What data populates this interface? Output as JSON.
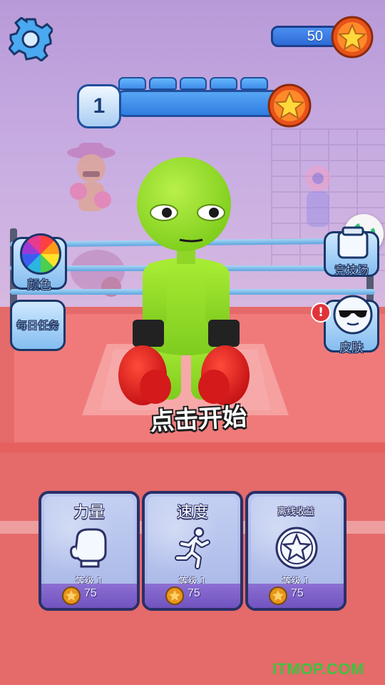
{
  "top": {
    "settings_icon": "gear-icon",
    "coins": "50",
    "coin_icon": "star-coin-icon"
  },
  "level": {
    "current": "1",
    "segments": 5,
    "reward_icon": "star-coin-icon"
  },
  "left_menu": {
    "color_label": "颜色",
    "daily_tasks_label": "每日任务"
  },
  "right_menu": {
    "arena_label": "竞技场",
    "skin_label": "皮肤",
    "alert_text": "!"
  },
  "center": {
    "tap_to_start": "点击开始"
  },
  "upgrades": [
    {
      "title": "力量",
      "icon": "boxing-glove-icon",
      "level": "等级 1",
      "cost": "75"
    },
    {
      "title": "速度",
      "icon": "running-man-icon",
      "level": "等级 1",
      "cost": "75"
    },
    {
      "title": "离线收益",
      "icon": "star-circle-icon",
      "level": "等级 1",
      "cost": "75"
    }
  ],
  "watermark": "ITMOP.COM",
  "colors": {
    "character": "#9be22a",
    "glove": "#e42020",
    "panel_blue": "#2f7de0",
    "card_footer": "#7053bf",
    "watermark": "#3ec23e"
  }
}
